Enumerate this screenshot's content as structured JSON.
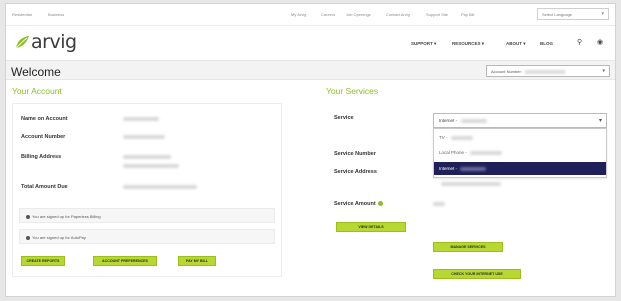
{
  "topbar": {
    "left_links": [
      "Residential",
      "Business"
    ],
    "right_links": [
      "My Arvig",
      "Careers",
      "Job Openings",
      "Contact Arvig",
      "Support Site",
      "Pay Bill"
    ],
    "language": "Select Language"
  },
  "header": {
    "logo_text": "arvig",
    "nav": [
      {
        "label": "SUPPORT ▾"
      },
      {
        "label": "RESOURCES ▾"
      },
      {
        "label": "ABOUT ▾"
      },
      {
        "label": "BLOG"
      }
    ]
  },
  "welcome": {
    "title": "Welcome",
    "account_select_label": "Account Number:"
  },
  "your_account": {
    "heading": "Your Account",
    "fields": [
      {
        "label": "Name on Account"
      },
      {
        "label": "Account Number"
      },
      {
        "label": "Billing Address"
      },
      {
        "label": "Total Amount Due"
      }
    ],
    "notes": [
      "You are signed up for Paperless Billing",
      "You are signed up for AutoPay"
    ],
    "buttons": [
      "CREATE REPORTS",
      "ACCOUNT PREFERENCES",
      "PAY MY BILL"
    ]
  },
  "your_services": {
    "heading": "Your Services",
    "fields": [
      {
        "label": "Service"
      },
      {
        "label": "Service Number"
      },
      {
        "label": "Service Address"
      },
      {
        "label": "Service Amount"
      }
    ],
    "service_select_value": "Internet -",
    "dropdown_options": [
      {
        "label": "TV -",
        "selected": false
      },
      {
        "label": "Local Phone -",
        "selected": false
      },
      {
        "label": "Internet -",
        "selected": true
      }
    ],
    "buttons": [
      "VIEW DETAILS",
      "MANAGE SERVICES",
      "CHECK YOUR INTERNET USE"
    ]
  },
  "colors": {
    "accent_green": "#8cbf26",
    "button_green": "#b7d833",
    "selected_navy": "#1f1f5a"
  }
}
